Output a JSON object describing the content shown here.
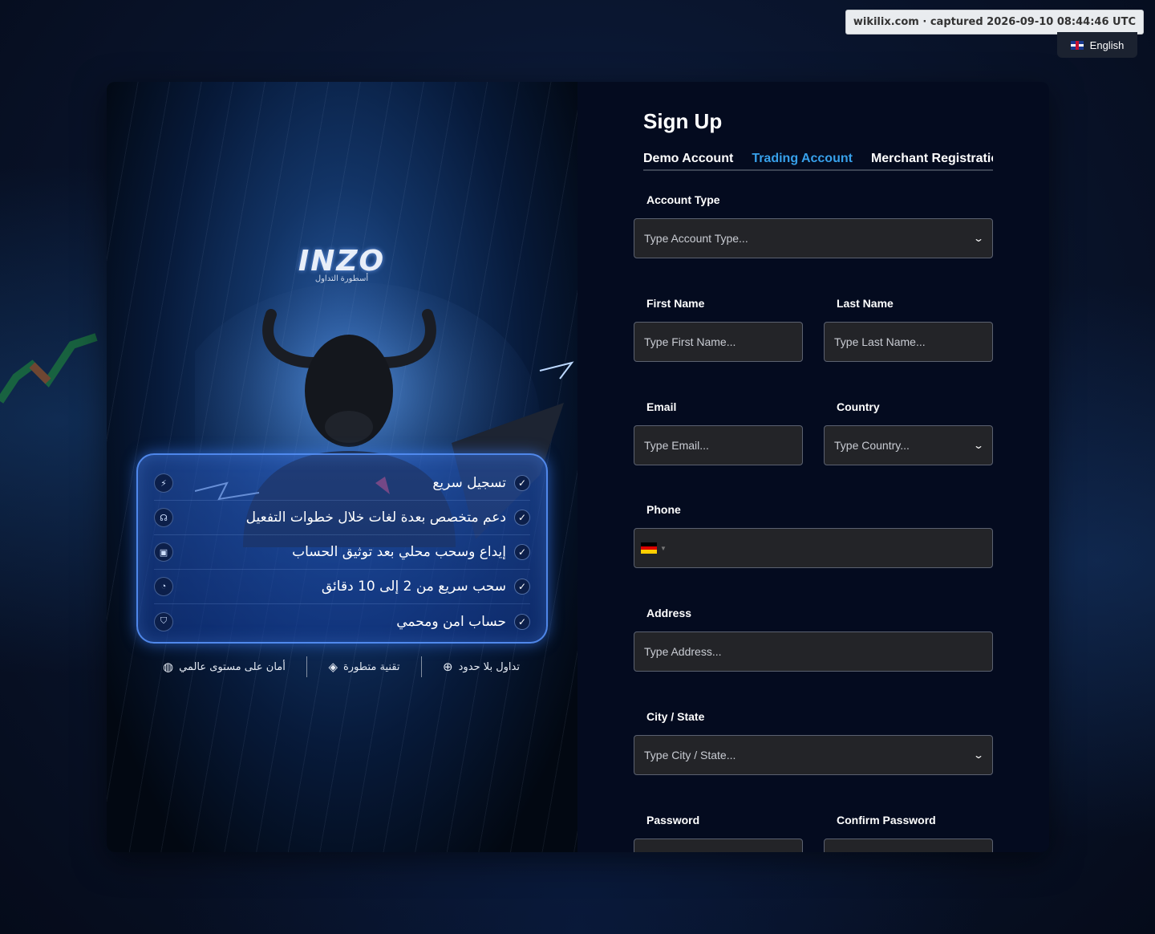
{
  "watermark": "wikilix.com · captured 2026-09-10 08:44:46 UTC",
  "language": {
    "label": "English",
    "icon": "uk-flag-icon"
  },
  "promo": {
    "logo_text": "INZO",
    "logo_tagline": "أسطورة التداول",
    "features": [
      {
        "text": "تسجيل سريع",
        "icon": "lightning-icon"
      },
      {
        "text": "دعم متخصص بعدة لغات خلال خطوات التفعيل",
        "icon": "headset-icon"
      },
      {
        "text": "إيداع وسحب محلي بعد توثيق الحساب",
        "icon": "wallet-icon"
      },
      {
        "text": "سحب سريع من 2 إلى 10 دقائق",
        "icon": "speed-icon"
      },
      {
        "text": "حساب امن ومحمي",
        "icon": "shield-icon"
      }
    ],
    "bottom": [
      {
        "text": "أمان على مستوى عالمي",
        "icon": "globe-shield-icon"
      },
      {
        "text": "تقنية متطورة",
        "icon": "layers-icon"
      },
      {
        "text": "تداول بلا حدود",
        "icon": "globe-icon"
      }
    ]
  },
  "form": {
    "title": "Sign Up",
    "tabs": [
      "Demo Account",
      "Trading Account",
      "Merchant Registration"
    ],
    "active_tab": "Trading Account",
    "account_type": {
      "label": "Account Type",
      "placeholder": "Type Account Type..."
    },
    "first_name": {
      "label": "First Name",
      "placeholder": "Type First Name..."
    },
    "last_name": {
      "label": "Last Name",
      "placeholder": "Type Last Name..."
    },
    "email": {
      "label": "Email",
      "placeholder": "Type Email..."
    },
    "country": {
      "label": "Country",
      "placeholder": "Type Country..."
    },
    "phone": {
      "label": "Phone",
      "flag": "germany-flag-icon"
    },
    "address": {
      "label": "Address",
      "placeholder": "Type Address..."
    },
    "city": {
      "label": "City / State",
      "placeholder": "Type City / State..."
    },
    "password": {
      "label": "Password"
    },
    "confirm_password": {
      "label": "Confirm Password"
    }
  },
  "colors": {
    "accent": "#37a0ea",
    "field_bg": "#232428",
    "panel_bg": "#040b1f"
  }
}
